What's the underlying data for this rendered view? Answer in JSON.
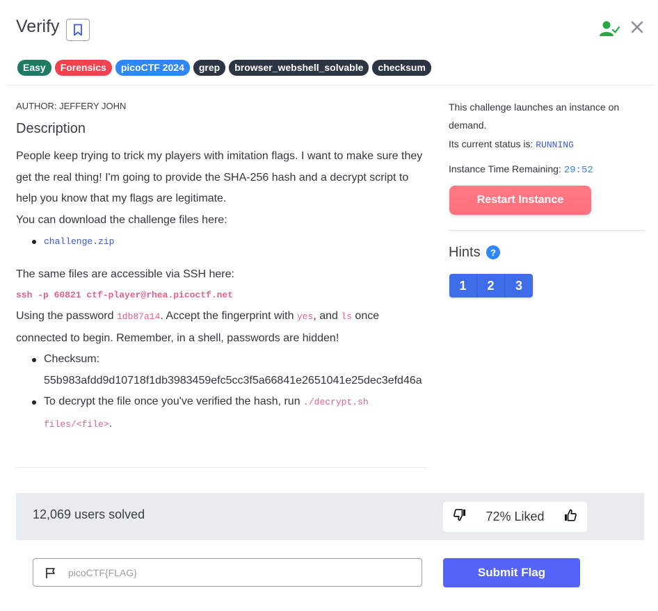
{
  "header": {
    "title": "Verify"
  },
  "tags": [
    {
      "label": "Easy",
      "color": "#1e7b63"
    },
    {
      "label": "Forensics",
      "color": "#f0434f"
    },
    {
      "label": "picoCTF 2024",
      "color": "#2f86f6"
    },
    {
      "label": "grep",
      "color": "#2c3544"
    },
    {
      "label": "browser_webshell_solvable",
      "color": "#2c3544"
    },
    {
      "label": "checksum",
      "color": "#2c3544"
    }
  ],
  "main": {
    "author": "AUTHOR: JEFFERY JOHN",
    "description_heading": "Description",
    "paragraph1": "People keep trying to trick my players with imitation flags. I want to make sure they get the real thing! I'm going to provide the SHA-256 hash and a decrypt script to help you know that my flags are legitimate.",
    "paragraph2": "You can download the challenge files here:",
    "download_link": "challenge.zip",
    "ssh_intro": "The same files are accessible via SSH here:",
    "ssh_command": "ssh -p 60821 ctf-player@rhea.picoctf.net",
    "pw_prefix": "Using the password ",
    "password": "1db87a14",
    "pw_mid": ". Accept the fingerprint with ",
    "yes_cmd": "yes",
    "pw_and": ", and ",
    "ls_cmd": "ls",
    "pw_suffix": " once connected to begin. Remember, in a shell, passwords are hidden!",
    "checksum_label": "Checksum:",
    "checksum_value": "55b983afdd9d10718f1db3983459efc5cc3f5a66841e2651041e25dec3efd46a",
    "decrypt_prefix": "To decrypt the file once you've verified the hash, run ",
    "decrypt_cmd": "./decrypt.sh files/<file>",
    "decrypt_suffix": "."
  },
  "instance": {
    "launch_text": "This challenge launches an instance on demand.",
    "status_label": "Its current status is: ",
    "status_value": "RUNNING",
    "time_label": "Instance Time Remaining: ",
    "time_value": "29:52",
    "restart_label": "Restart Instance"
  },
  "hints": {
    "heading": "Hints",
    "help_glyph": "?",
    "buttons": [
      "1",
      "2",
      "3"
    ]
  },
  "stats": {
    "solved": "12,069 users solved",
    "liked": "72% Liked"
  },
  "flag": {
    "placeholder": "picoCTF{FLAG}",
    "submit_label": "Submit Flag"
  },
  "colors": {
    "running": "#3b5bdb",
    "timer": "#2f86f6",
    "user_icon": "#28a745",
    "code_pink": "#e06287",
    "submit_bg": "#5464f6"
  }
}
